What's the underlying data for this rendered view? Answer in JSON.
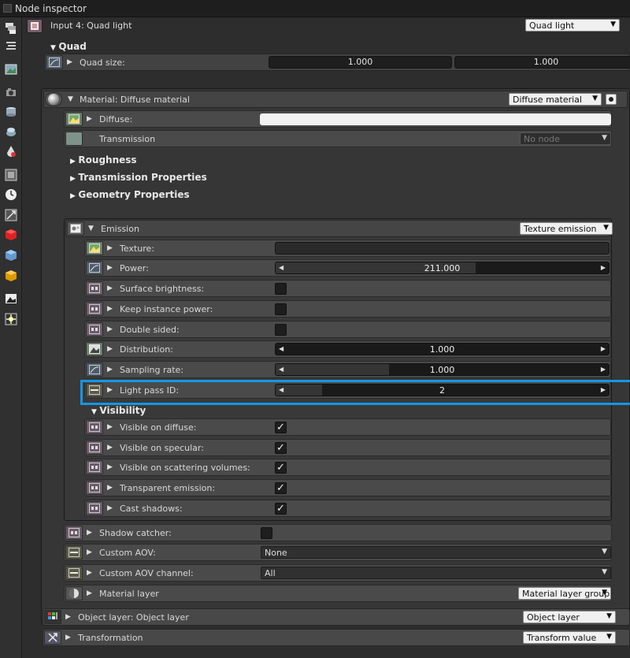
{
  "window": {
    "title": "Node inspector"
  },
  "node": {
    "title": "Input 4: Quad light",
    "type": "Quad light"
  },
  "quad": {
    "section": "Quad",
    "size_label": "Quad size:",
    "size_x": "1.000",
    "size_y": "1.000"
  },
  "material": {
    "title": "Material: Diffuse material",
    "type": "Diffuse material",
    "diffuse_label": "Diffuse:",
    "transmission_label": "Transmission",
    "transmission_value": "No node",
    "roughness": "Roughness",
    "transmission_props": "Transmission Properties",
    "geometry_props": "Geometry Properties"
  },
  "emission": {
    "title": "Emission",
    "type": "Texture emission",
    "texture_label": "Texture:",
    "power_label": "Power:",
    "power_value": "211.000",
    "power_fill": 0.6,
    "surface_brightness_label": "Surface brightness:",
    "keep_instance_power_label": "Keep instance power:",
    "double_sided_label": "Double sided:",
    "distribution_label": "Distribution:",
    "distribution_value": "1.000",
    "distribution_fill": 0.0,
    "sampling_rate_label": "Sampling rate:",
    "sampling_rate_value": "1.000",
    "sampling_rate_fill": 0.34,
    "light_pass_id_label": "Light pass ID:",
    "light_pass_id_value": "2",
    "light_pass_id_fill": 0.14
  },
  "visibility": {
    "section": "Visibility",
    "items": [
      {
        "label": "Visible on diffuse:",
        "checked": "✓"
      },
      {
        "label": "Visible on specular:",
        "checked": "✓"
      },
      {
        "label": "Visible on scattering volumes:",
        "checked": "✓"
      },
      {
        "label": "Transparent emission:",
        "checked": "✓"
      },
      {
        "label": "Cast shadows:",
        "checked": "✓"
      }
    ]
  },
  "extras": {
    "shadow_catcher_label": "Shadow catcher:",
    "custom_aov_label": "Custom AOV:",
    "custom_aov_value": "None",
    "custom_aov_channel_label": "Custom AOV channel:",
    "custom_aov_channel_value": "All",
    "material_layer_label": "Material layer",
    "material_layer_value": "Material layer group"
  },
  "object_layer": {
    "title": "Object layer: Object layer",
    "type": "Object layer"
  },
  "transformation": {
    "title": "Transformation",
    "type": "Transform value"
  },
  "colors": {
    "highlight": "#1596e6",
    "diffuse_color": "#f2f2f2"
  }
}
